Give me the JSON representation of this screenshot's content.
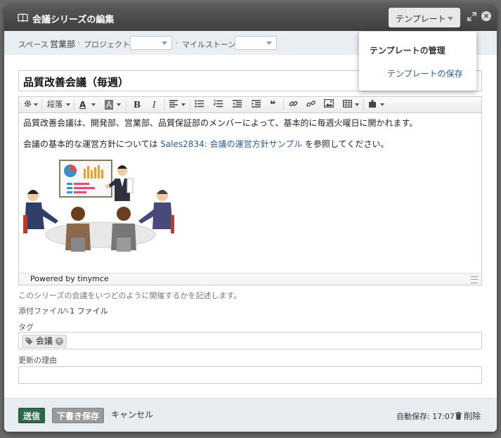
{
  "dialog": {
    "title": "会議シリーズの編集",
    "template_button": "テンプレート",
    "template_menu": {
      "header": "テンプレートの管理",
      "items": [
        "テンプレートの保存"
      ]
    }
  },
  "breadcrumb": {
    "space_label": "スペース",
    "space_value": "営業部",
    "project_label": "プロジェクト",
    "project_value": "",
    "milestone_label": "マイルストーン",
    "milestone_value": ""
  },
  "title_field": {
    "value": "品質改善会議（毎週）"
  },
  "editor": {
    "toolbar": {
      "paragraph": "段落",
      "text_color_glyph": "A",
      "bg_color_glyph": "A",
      "bold": "B",
      "italic": "I",
      "quote_glyph": "❝"
    },
    "paragraph1": "品質改善会議は、開発部、営業部、品質保証部のメンバーによって、基本的に毎週火曜日に開かれます。",
    "paragraph2_before": "会議の基本的な運営方針については",
    "paragraph2_link": "Sales2834: 会議の運営方針サンプル",
    "paragraph2_after": "を参照してください。",
    "powered_by": "Powered by tinymce"
  },
  "help_text": "このシリーズの会議をいつどのように開催するかを記述します。",
  "attachments": {
    "label": "添付ファイル",
    "count": "1 ファイル"
  },
  "tags": {
    "label": "タグ",
    "items": [
      "会議"
    ]
  },
  "reason": {
    "label": "更新の理由",
    "value": ""
  },
  "footer": {
    "submit": "送信",
    "draft": "下書き保存",
    "cancel": "キャンセル",
    "autosave": "自動保存: 17:07",
    "delete": "削除"
  },
  "colors": {
    "title_bar": "#4a4a4a",
    "submit": "#2d6a4a",
    "link": "#2c5aa0"
  }
}
